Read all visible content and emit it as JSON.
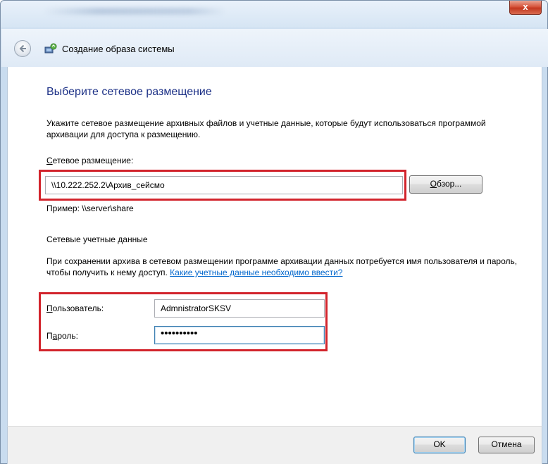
{
  "window": {
    "close_label": "x"
  },
  "nav": {
    "title": "Создание образа системы"
  },
  "page": {
    "heading": "Выберите сетевое размещение",
    "description": "Укажите сетевое размещение архивных файлов и учетные данные, которые будут использоваться программой архивации для доступа к размещению.",
    "location_label_accel": "С",
    "location_label_rest": "етевое размещение:",
    "location_value": "\\\\10.222.252.2\\Архив_сейсмо",
    "browse_accel": "О",
    "browse_rest": "бзор...",
    "example": "Пример: \\\\server\\share",
    "credentials_section": "Сетевые учетные данные",
    "credentials_description": "При сохранении архива в сетевом размещении программе архивации данных потребуется имя пользователя и пароль, чтобы получить к нему доступ.",
    "credentials_link": "Какие учетные данные необходимо ввести?",
    "user_label_accel": "П",
    "user_label_rest": "ользователь:",
    "user_value": "AdmnistratorSKSV",
    "password_label_pre": "П",
    "password_label_accel": "а",
    "password_label_rest": "роль:",
    "password_value": "••••••••••"
  },
  "footer": {
    "ok_label": "OK",
    "cancel_label": "Отмена"
  },
  "colors": {
    "heading": "#1e3287",
    "highlight": "#d2242c",
    "link": "#0066cc"
  }
}
